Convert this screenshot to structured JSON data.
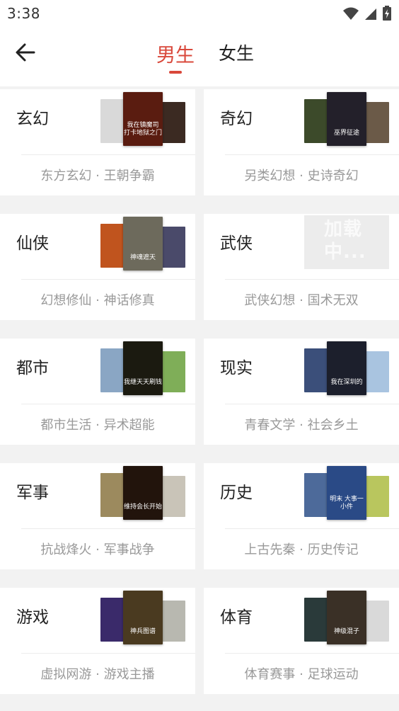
{
  "status_bar": {
    "time": "3:38"
  },
  "header": {
    "tabs": [
      {
        "label": "男生",
        "active": true
      },
      {
        "label": "女生",
        "active": false
      }
    ],
    "accent_color": "#d9483b"
  },
  "categories": [
    {
      "title": "玄幻",
      "subtitle": "东方玄幻 · 王朝争霸",
      "covers": {
        "left": "#d9d9d9",
        "front": "#5a1c10",
        "right": "#3b2a22",
        "front_text": "我在镇魔司 打卡地狱之门"
      }
    },
    {
      "title": "奇幻",
      "subtitle": "另类幻想 · 史诗奇幻",
      "covers": {
        "left": "#3c4a2a",
        "front": "#23202a",
        "right": "#6b5a48",
        "front_text": "巫界征途"
      }
    },
    {
      "title": "仙侠",
      "subtitle": "幻想修仙 · 神话修真",
      "covers": {
        "left": "#c0541e",
        "front": "#6d6a5c",
        "right": "#4a4a6a",
        "front_text": "神魂遮天"
      }
    },
    {
      "title": "武侠",
      "subtitle": "武侠幻想 · 国术无双",
      "loading": true,
      "loading_text": "加载中..."
    },
    {
      "title": "都市",
      "subtitle": "都市生活 · 异术超能",
      "covers": {
        "left": "#8aa6c4",
        "front": "#1b1a10",
        "right": "#7fae58",
        "front_text": "我继天天刷钱"
      }
    },
    {
      "title": "现实",
      "subtitle": "青春文学 · 社会乡土",
      "covers": {
        "left": "#3b4f7a",
        "front": "#1c1f2c",
        "right": "#a9c4e0",
        "front_text": "我在深圳的"
      }
    },
    {
      "title": "军事",
      "subtitle": "抗战烽火 · 军事战争",
      "covers": {
        "left": "#9c8a5e",
        "front": "#22140c",
        "right": "#c9c4b8",
        "front_text": "维持会长开始"
      }
    },
    {
      "title": "历史",
      "subtitle": "上古先秦 · 历史传记",
      "covers": {
        "left": "#4d6a9a",
        "front": "#2a4a86",
        "right": "#b9c65e",
        "front_text": "明末 大事一小件"
      }
    },
    {
      "title": "游戏",
      "subtitle": "虚拟网游 · 游戏主播",
      "covers": {
        "left": "#3a2a6a",
        "front": "#4a3a20",
        "right": "#b8b8b0",
        "front_text": "神兵图谱"
      }
    },
    {
      "title": "体育",
      "subtitle": "体育赛事 · 足球运动",
      "covers": {
        "left": "#2a3a3a",
        "front": "#3a3026",
        "right": "#d9d9d9",
        "front_text": "神级混子"
      }
    }
  ]
}
